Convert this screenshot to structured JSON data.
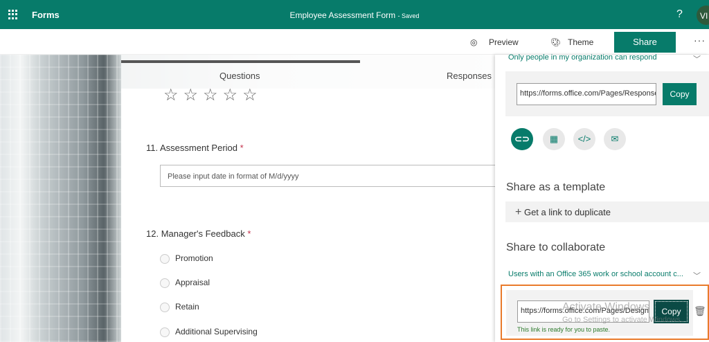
{
  "header": {
    "app_name": "Forms",
    "form_title": "Employee Assessment Form",
    "save_status": "- Saved",
    "help": "?",
    "avatar_initials": "VI"
  },
  "toolbar": {
    "preview": "Preview",
    "theme": "Theme",
    "share": "Share",
    "more": "···"
  },
  "tabs": {
    "questions": "Questions",
    "responses": "Responses"
  },
  "form": {
    "stars": "☆☆☆☆☆",
    "q11": {
      "number": "11.",
      "title": "Assessment Period",
      "required": "*",
      "placeholder": "Please input date in format of M/d/yyyy"
    },
    "q12": {
      "number": "12.",
      "title": "Manager's Feedback",
      "required": "*",
      "options": [
        "Promotion",
        "Appraisal",
        "Retain",
        "Additional Supervising"
      ]
    }
  },
  "share_panel": {
    "respond_scope": "Only people in my organization can respond",
    "respond_url": "https://forms.office.com/Pages/ResponsePage",
    "copy": "Copy",
    "icons": [
      "link-icon",
      "qr-code-icon",
      "embed-icon",
      "email-icon"
    ],
    "template_heading": "Share as a template",
    "duplicate_link": "Get a link to duplicate",
    "collab_heading": "Share to collaborate",
    "collab_scope": "Users with an Office 365 work or school account c...",
    "collab_url": "https://forms.office.com/Pages/DesignPage",
    "collab_copy": "Copy",
    "ready_msg": "This link is ready for you to paste."
  },
  "watermark": {
    "line1": "Activate Windows",
    "line2": "Go to Settings to activate Windows."
  }
}
